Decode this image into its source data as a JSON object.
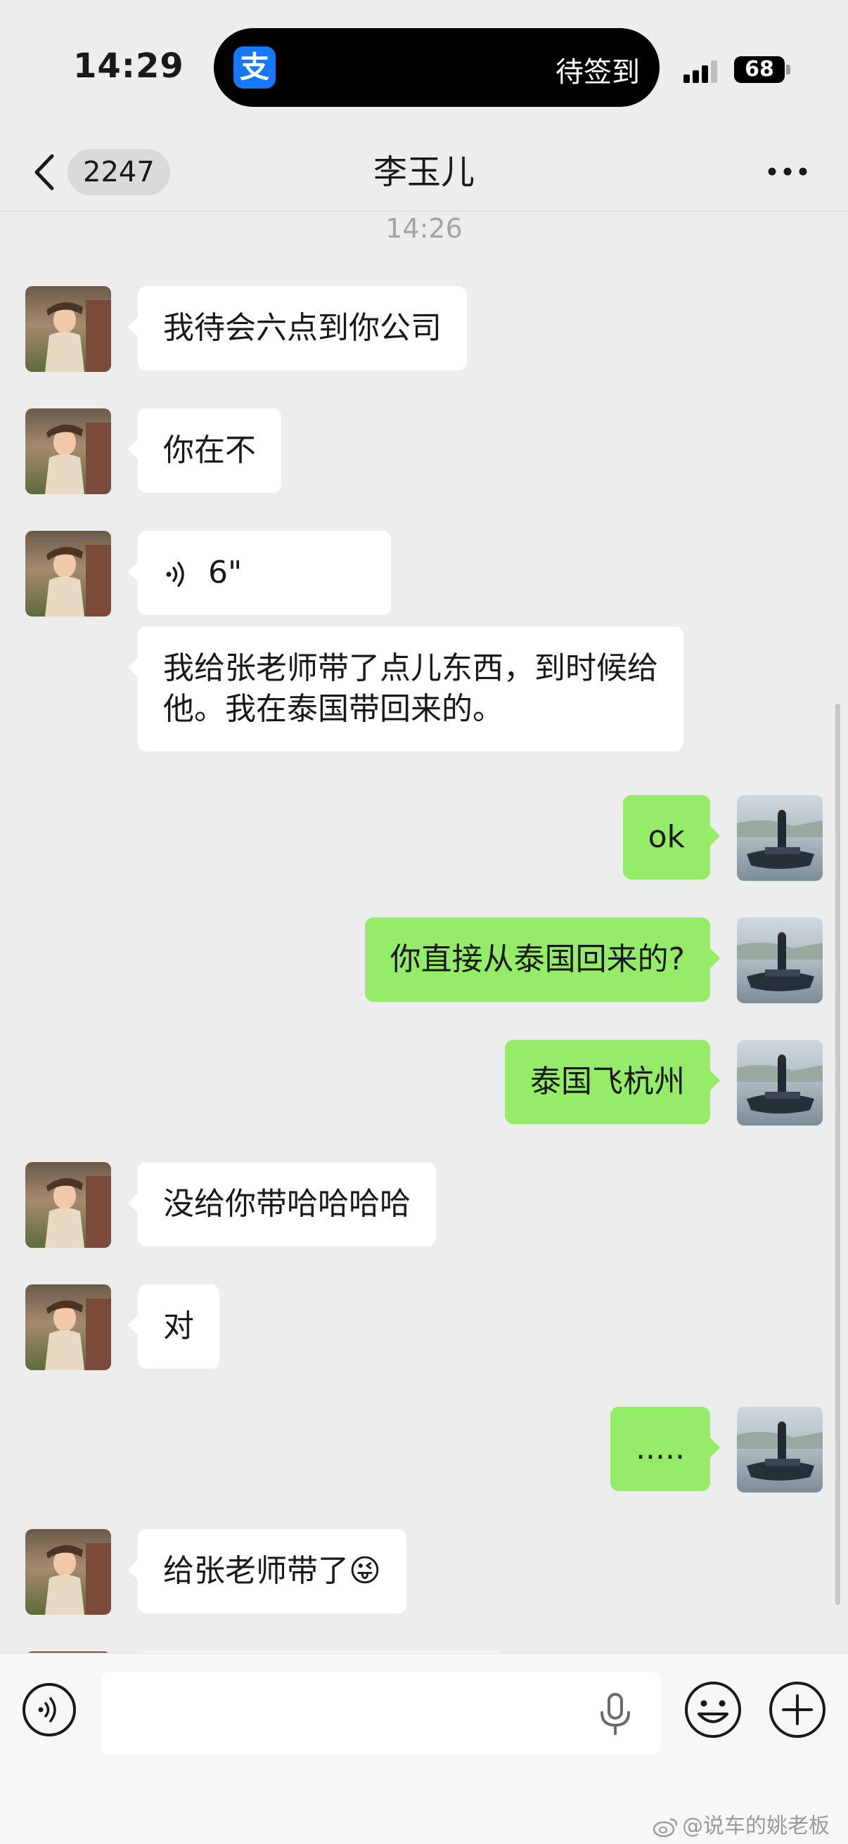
{
  "status_bar": {
    "time": "14:29",
    "app_icon_glyph": "支",
    "live_activity_text": "待签到",
    "battery_level": "68"
  },
  "header": {
    "unread_count": "2247",
    "title": "李玉儿"
  },
  "chat": {
    "timestamp": "14:26",
    "messages": [
      {
        "side": "in",
        "text": "我待会六点到你公司"
      },
      {
        "side": "in",
        "text": "你在不"
      },
      {
        "side": "in",
        "type": "voice",
        "text": "6\""
      },
      {
        "side": "in",
        "text": "我给张老师带了点儿东西，到时候给他。我在泰国带回来的。"
      },
      {
        "side": "out",
        "text": "ok"
      },
      {
        "side": "out",
        "text": "你直接从泰国回来的?"
      },
      {
        "side": "out",
        "text": "泰国飞杭州"
      },
      {
        "side": "in",
        "text": "没给你带哈哈哈哈"
      },
      {
        "side": "in",
        "text": "对"
      },
      {
        "side": "out",
        "text": "....."
      },
      {
        "side": "in",
        "text": "给张老师带了",
        "emoji": "😜"
      }
    ]
  },
  "input_bar": {
    "watermark": "@说车的姚老板"
  },
  "colors": {
    "background": "#ededed",
    "incoming_bubble": "#ffffff",
    "outgoing_bubble": "#95ec69",
    "alipay_blue": "#1677ff"
  },
  "icons": [
    "back-icon",
    "more-icon",
    "voice-icon",
    "mic-icon",
    "emoji-icon",
    "plus-icon",
    "weibo-icon"
  ]
}
